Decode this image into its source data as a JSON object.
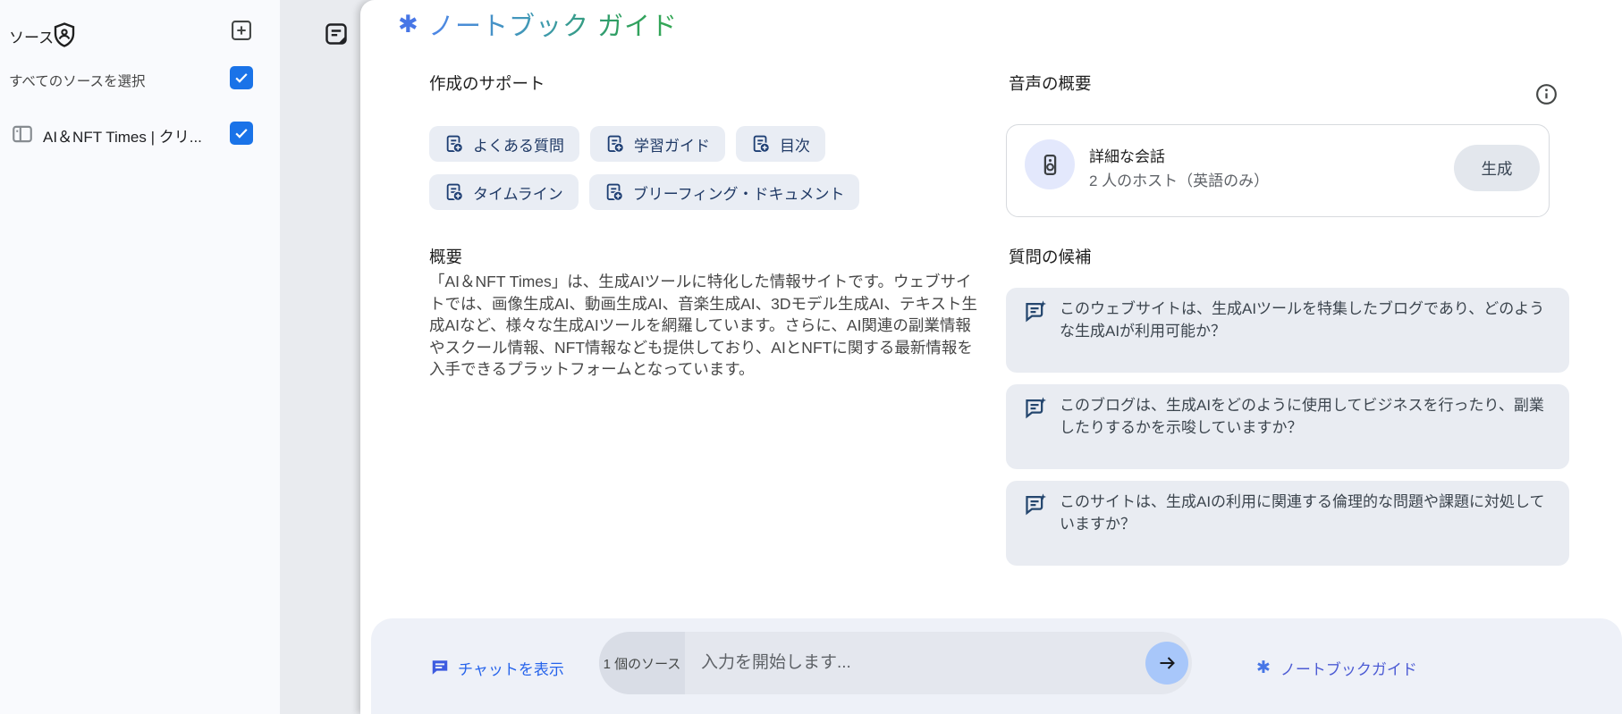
{
  "sidebar": {
    "title": "ソース",
    "select_all_label": "すべてのソースを選択",
    "source": {
      "title": "AI＆NFT Times | クリ..."
    }
  },
  "guide": {
    "sparkle": "✱",
    "title": "ノートブック ガイド",
    "support": {
      "heading": "作成のサポート",
      "chips": [
        "よくある質問",
        "学習ガイド",
        "目次",
        "タイムライン",
        "ブリーフィング・ドキュメント"
      ]
    },
    "audio": {
      "heading": "音声の概要",
      "card_title": "詳細な会話",
      "card_subtitle": "2 人のホスト（英語のみ）",
      "generate_label": "生成"
    },
    "summary": {
      "heading": "概要",
      "text": "「AI＆NFT Times」は、生成AIツールに特化した情報サイトです。ウェブサイトでは、画像生成AI、動画生成AI、音楽生成AI、3Dモデル生成AI、テキスト生成AIなど、様々な生成AIツールを網羅しています。さらに、AI関連の副業情報やスクール情報、NFT情報なども提供しており、AIとNFTに関する最新情報を入手できるプラットフォームとなっています。"
    },
    "questions": {
      "heading": "質問の候補",
      "items": [
        "このウェブサイトは、生成AIツールを特集したブログであり、どのような生成AIが利用可能か？",
        "このブログは、生成AIをどのように使用してビジネスを行ったり、副業したりするかを示唆していますか？",
        "このサイトは、生成AIの利用に関連する倫理的な問題や課題に対処していますか？"
      ]
    }
  },
  "bottom_bar": {
    "show_chat_label": "チャットを表示",
    "source_count_label": "1 個のソース",
    "input_placeholder": "入力を開始します...",
    "guide_label": "ノートブックガイド",
    "guide_sparkle": "✱"
  },
  "colors": {
    "accent_blue": "#1a73e8",
    "title_gradient_start": "#4e86e8",
    "title_gradient_end": "#34a853",
    "chip_bg": "#e9edf4",
    "card_bg": "#e9ecf2",
    "send_button_bg": "#a8c7fa"
  }
}
